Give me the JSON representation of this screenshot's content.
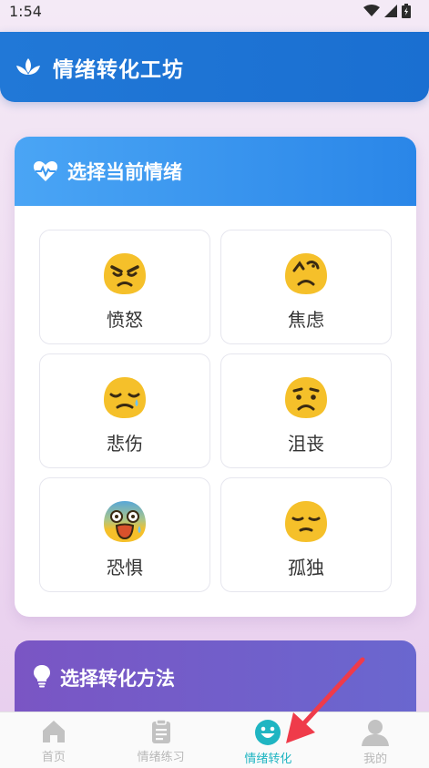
{
  "status": {
    "time": "1:54"
  },
  "header": {
    "title": "情绪转化工坊"
  },
  "emotion_card": {
    "title": "选择当前情绪",
    "emotions": [
      {
        "label": "愤怒",
        "icon": "angry-face-icon"
      },
      {
        "label": "焦虑",
        "icon": "anxious-face-icon"
      },
      {
        "label": "悲伤",
        "icon": "sad-face-icon"
      },
      {
        "label": "沮丧",
        "icon": "frustrated-face-icon"
      },
      {
        "label": "恐惧",
        "icon": "fearful-face-icon"
      },
      {
        "label": "孤独",
        "icon": "lonely-face-icon"
      }
    ]
  },
  "method_card": {
    "title": "选择转化方法"
  },
  "tabbar": {
    "items": [
      {
        "label": "首页",
        "icon": "home-icon"
      },
      {
        "label": "情绪练习",
        "icon": "clipboard-icon"
      },
      {
        "label": "情绪转化",
        "icon": "smile-icon",
        "active": true
      },
      {
        "label": "我的",
        "icon": "user-icon"
      }
    ]
  },
  "colors": {
    "header": "#1a6fd1",
    "active_tab": "#1fb5c2",
    "annotation_arrow": "#ef3b4a"
  }
}
